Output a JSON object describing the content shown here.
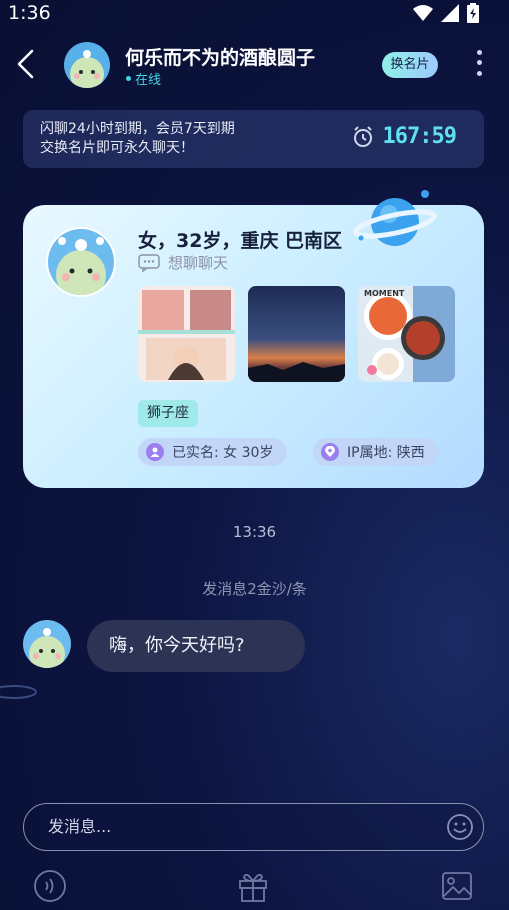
{
  "status_bar": {
    "time": "1:36"
  },
  "header": {
    "name": "何乐而不为的酒酿圆子",
    "online_status": "在线",
    "swap_card_label": "换名片"
  },
  "notice": {
    "line1": "闪聊24小时到期，会员7天到期",
    "line2": "交换名片即可永久聊天！",
    "timer": "167:59"
  },
  "profile_card": {
    "title": "女，32岁，重庆 巴南区",
    "subtitle": "想聊聊天",
    "tag": "狮子座",
    "verified": "已实名: 女 30岁",
    "ip": "IP属地: 陕西",
    "photo_caption": "MOMENT"
  },
  "chat": {
    "time": "13:36",
    "cost_hint": "发消息2金沙/条",
    "messages": [
      {
        "text": "嗨，你今天好吗?"
      }
    ]
  },
  "input": {
    "placeholder": "发消息..."
  },
  "colors": {
    "accent": "#44d3e6",
    "background": "#0c1440",
    "card": "#cdefff"
  }
}
